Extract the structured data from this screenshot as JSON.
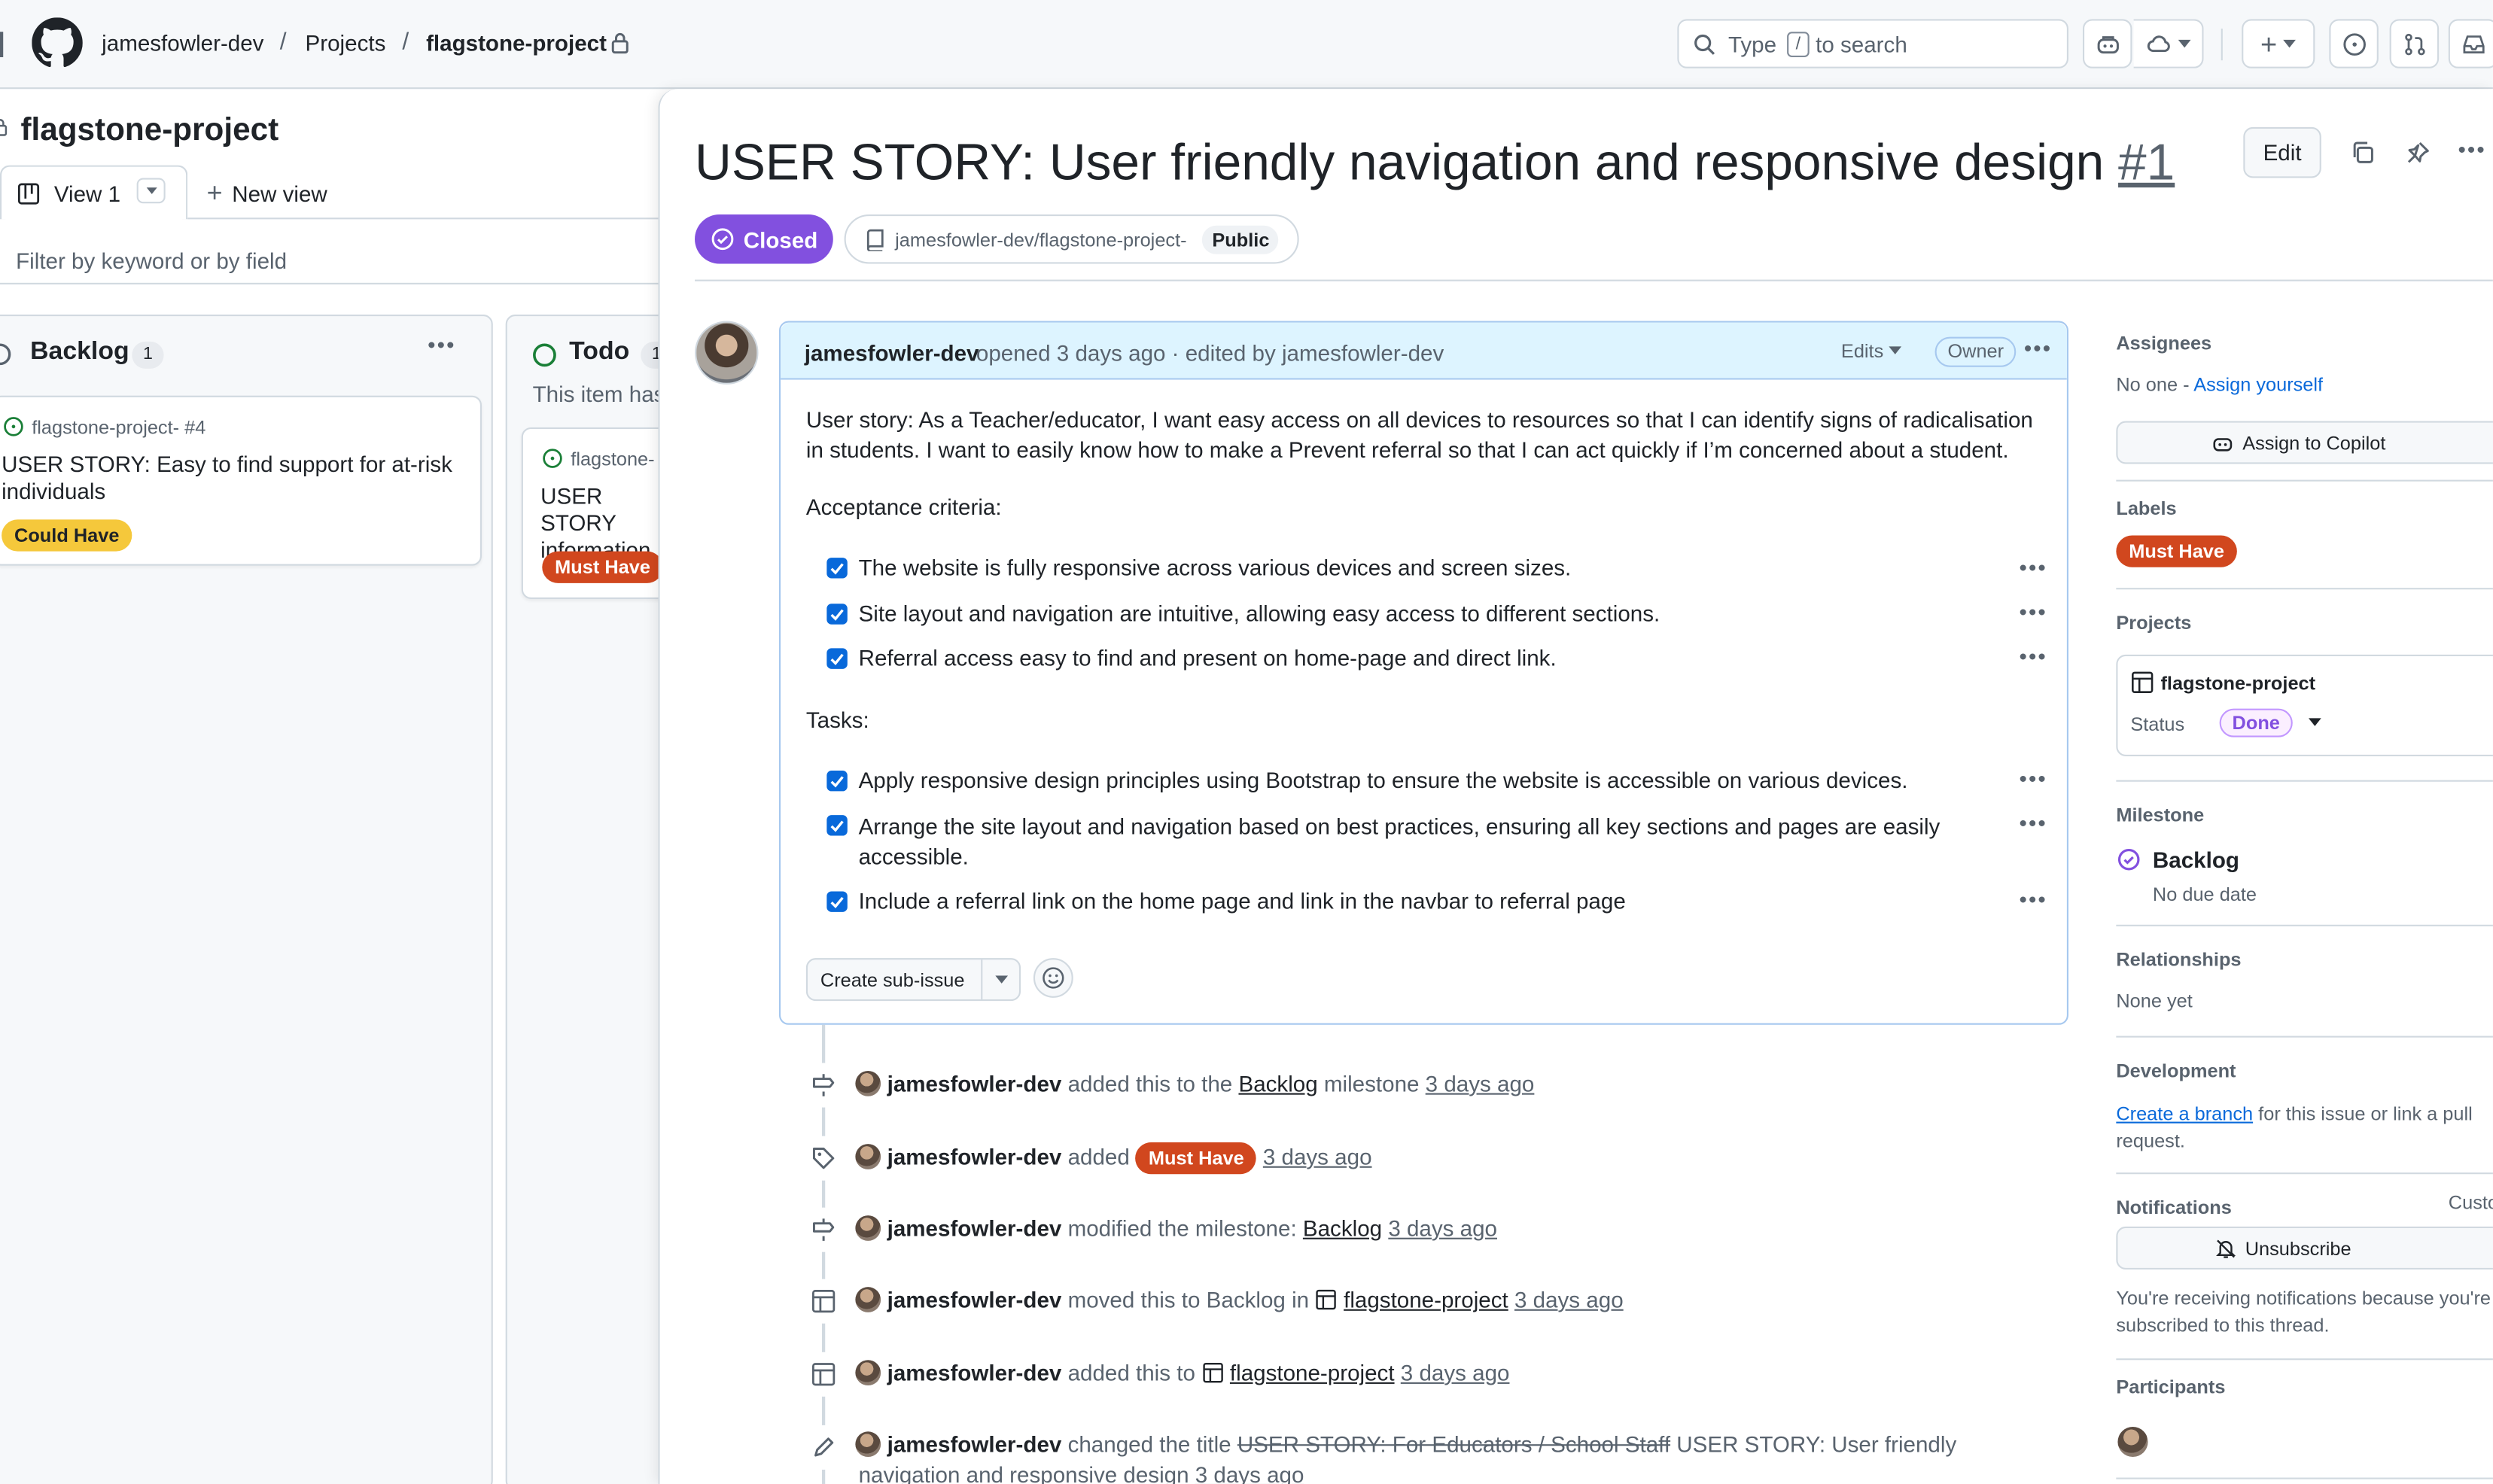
{
  "header": {
    "owner": "jamesfowler-dev",
    "projects": "Projects",
    "project": "flagstone-project",
    "search_prefix": "Type",
    "search_key": "/",
    "search_suffix": "to search"
  },
  "board": {
    "title": "flagstone-project",
    "view_tab": "View 1",
    "new_view": "New view",
    "filter_placeholder": "Filter by keyword or by field",
    "columns": [
      {
        "name": "Backlog",
        "count": "1",
        "card": {
          "ref": "flagstone-project- #4",
          "title": "USER STORY: Easy to find support for at-risk individuals",
          "label": "Could Have"
        }
      },
      {
        "name": "Todo",
        "count": "1",
        "note": "This item has",
        "card": {
          "ref": "flagstone-",
          "title": "USER STORY information",
          "label": "Must Have"
        }
      }
    ]
  },
  "issue": {
    "title": "USER STORY: User friendly navigation and responsive design",
    "number": "#1",
    "edit_label": "Edit",
    "state": "Closed",
    "repo": "jamesfowler-dev/flagstone-project-",
    "visibility": "Public",
    "comment": {
      "author": "jamesfowler-dev",
      "meta": "opened 3 days ago · edited by jamesfowler-dev",
      "edits": "Edits",
      "role": "Owner",
      "story": "User story: As a Teacher/educator, I want easy access on all devices to resources so that I can identify signs of radicalisation in students. I want to easily know how to make a Prevent referral so that I can act quickly if I’m concerned about a student.",
      "acceptance_heading": "Acceptance criteria:",
      "acceptance": [
        "The website is fully responsive across various devices and screen sizes.",
        "Site layout and navigation are intuitive, allowing easy access to different sections.",
        "Referral access easy to find and present on home-page and direct link."
      ],
      "tasks_heading": "Tasks:",
      "tasks": [
        "Apply responsive design principles using Bootstrap to ensure the website is accessible on various devices.",
        "Arrange the site layout and navigation based on best practices, ensuring all key sections and pages are easily accessible.",
        "Include a referral link on the home page and link in the navbar to referral page"
      ],
      "sub_issue": "Create sub-issue"
    },
    "timeline": [
      {
        "user": "jamesfowler-dev",
        "a": "added this to the",
        "link": "Backlog",
        "b": "milestone",
        "time": "3 days ago"
      },
      {
        "user": "jamesfowler-dev",
        "a": "added",
        "label": "Must Have",
        "time": "3 days ago"
      },
      {
        "user": "jamesfowler-dev",
        "a": "modified the milestone:",
        "link": "Backlog",
        "time": "3 days ago"
      },
      {
        "user": "jamesfowler-dev",
        "a": "moved this to Backlog in",
        "link": "flagstone-project",
        "time": "3 days ago"
      },
      {
        "user": "jamesfowler-dev",
        "a": "added this to",
        "link": "flagstone-project",
        "time": "3 days ago"
      },
      {
        "user": "jamesfowler-dev",
        "a": "changed the title",
        "old": "USER STORY: For Educators / School Staff",
        "new1": "USER STORY: User friendly",
        "new2": "navigation and responsive design",
        "time": "3 days ago"
      }
    ]
  },
  "sidebar": {
    "assignees_h": "Assignees",
    "assignees_none": "No one -",
    "assign_self": "Assign yourself",
    "assign_copilot": "Assign to Copilot",
    "labels_h": "Labels",
    "label": "Must Have",
    "projects_h": "Projects",
    "project": "flagstone-project",
    "status_k": "Status",
    "status_v": "Done",
    "milestone_h": "Milestone",
    "milestone": "Backlog",
    "due": "No due date",
    "relationships_h": "Relationships",
    "relationships": "None yet",
    "development_h": "Development",
    "dev_link": "Create a branch",
    "dev_text1": "for this issue or link a pull",
    "dev_text2": "request.",
    "notifications_h": "Notifications",
    "customize": "Custo",
    "unsubscribe": "Unsubscribe",
    "notif1": "You're receiving notifications because you're",
    "notif2": "subscribed to this thread.",
    "participants_h": "Participants"
  },
  "colors": {
    "closed": "#8250df",
    "must_have": "#d1471e",
    "could_have": "#f5c83b",
    "link": "#0969da"
  }
}
